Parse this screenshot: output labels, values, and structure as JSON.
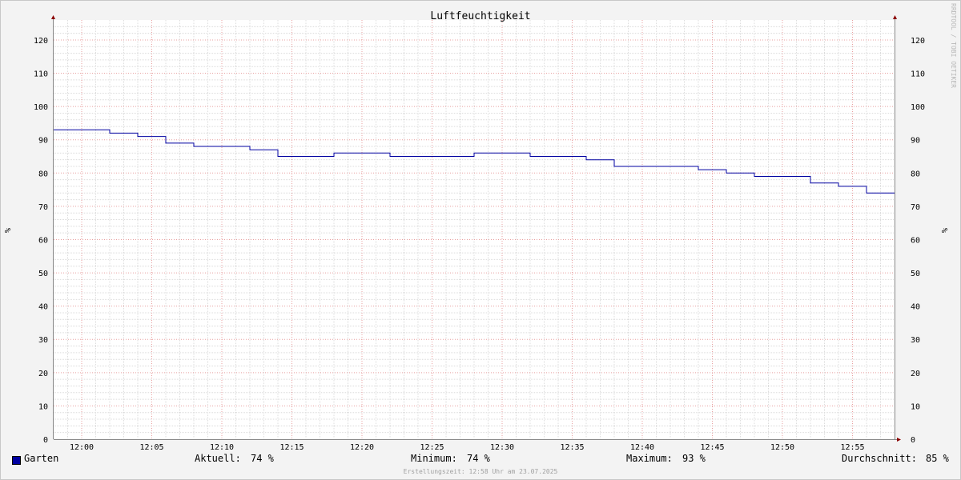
{
  "chart_data": {
    "type": "line",
    "title": "Luftfeuchtigkeit",
    "ylabel": "%",
    "ylabel_right": "%",
    "ylim": [
      0,
      126
    ],
    "yticks": [
      0,
      10,
      20,
      30,
      40,
      50,
      60,
      70,
      80,
      90,
      100,
      110,
      120
    ],
    "xlim": [
      "11:58",
      "12:58"
    ],
    "xticks": [
      "12:00",
      "12:05",
      "12:10",
      "12:15",
      "12:20",
      "12:25",
      "12:30",
      "12:35",
      "12:40",
      "12:45",
      "12:50",
      "12:55"
    ],
    "grid": true,
    "legend_position": "bottom",
    "series": [
      {
        "name": "Garten",
        "color": "#0000a0",
        "step": "post",
        "points": [
          [
            "11:58",
            93
          ],
          [
            "12:02",
            92
          ],
          [
            "12:04",
            91
          ],
          [
            "12:06",
            89
          ],
          [
            "12:08",
            88
          ],
          [
            "12:12",
            87
          ],
          [
            "12:14",
            85
          ],
          [
            "12:18",
            86
          ],
          [
            "12:22",
            85
          ],
          [
            "12:28",
            86
          ],
          [
            "12:32",
            85
          ],
          [
            "12:36",
            84
          ],
          [
            "12:38",
            82
          ],
          [
            "12:44",
            81
          ],
          [
            "12:46",
            80
          ],
          [
            "12:48",
            79
          ],
          [
            "12:52",
            77
          ],
          [
            "12:54",
            76
          ],
          [
            "12:56",
            74
          ],
          [
            "12:58",
            74
          ]
        ]
      }
    ],
    "stats": {
      "current_label": "Aktuell:",
      "current_value": "74 %",
      "min_label": "Minimum:",
      "min_value": "74 %",
      "max_label": "Maximum:",
      "max_value": "93 %",
      "avg_label": "Durchschnitt:",
      "avg_value": "85 %"
    }
  },
  "footer": "Erstellungszeit: 12:58 Uhr am 23.07.2025",
  "watermark": "RRDTOOL / TOBI OETIKER",
  "colors": {
    "background": "#f3f3f3",
    "plot_background": "#ffffff",
    "major_grid": "#e8a0a0",
    "minor_grid": "#dcdcdc",
    "axis": "#888888",
    "arrow": "#8b0000"
  }
}
